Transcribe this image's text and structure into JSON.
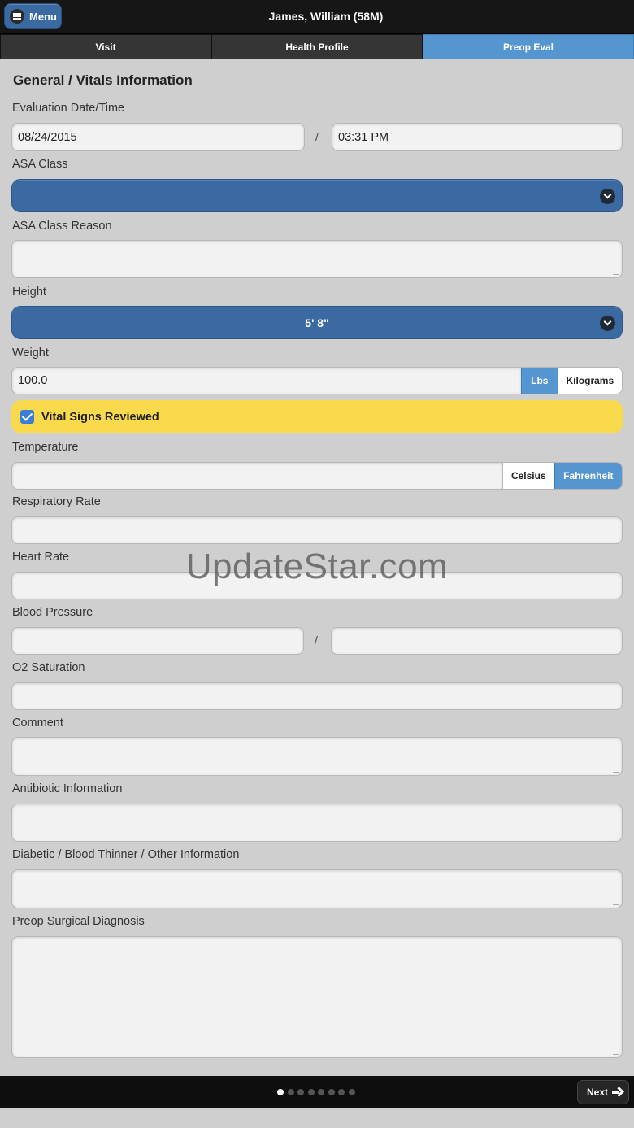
{
  "header": {
    "menu_label": "Menu",
    "patient": "James, William (58M)"
  },
  "tabs": [
    {
      "label": "Visit",
      "active": false
    },
    {
      "label": "Health Profile",
      "active": false
    },
    {
      "label": "Preop Eval",
      "active": true
    }
  ],
  "form": {
    "section_title": "General / Vitals Information",
    "eval_label": "Evaluation Date/Time",
    "eval_date": "08/24/2015",
    "eval_time": "03:31 PM",
    "separator": "/",
    "asa_class_label": "ASA Class",
    "asa_class_value": "",
    "asa_reason_label": "ASA Class Reason",
    "height_label": "Height",
    "height_value": "5' 8\"",
    "weight_label": "Weight",
    "weight_value": "100.0",
    "weight_units": [
      "Lbs",
      "Kilograms"
    ],
    "weight_unit_selected": "Lbs",
    "vital_reviewed_label": "Vital Signs Reviewed",
    "vital_reviewed_checked": true,
    "temperature_label": "Temperature",
    "temperature_units": [
      "Celsius",
      "Fahrenheit"
    ],
    "temperature_unit_selected": "Fahrenheit",
    "resp_rate_label": "Respiratory Rate",
    "heart_rate_label": "Heart Rate",
    "bp_label": "Blood Pressure",
    "o2_label": "O2 Saturation",
    "comment_label": "Comment",
    "antibiotic_label": "Antibiotic Information",
    "diabetic_label": "Diabetic / Blood Thinner / Other Information",
    "diagnosis_label": "Preop Surgical Diagnosis"
  },
  "watermark": "UpdateStar.com",
  "footer": {
    "next_label": "Next",
    "page_count": 8,
    "current_page": 1
  },
  "colors": {
    "accent": "#3b6aa3",
    "tab_active": "#5596d0",
    "highlight": "#f9da4c"
  }
}
